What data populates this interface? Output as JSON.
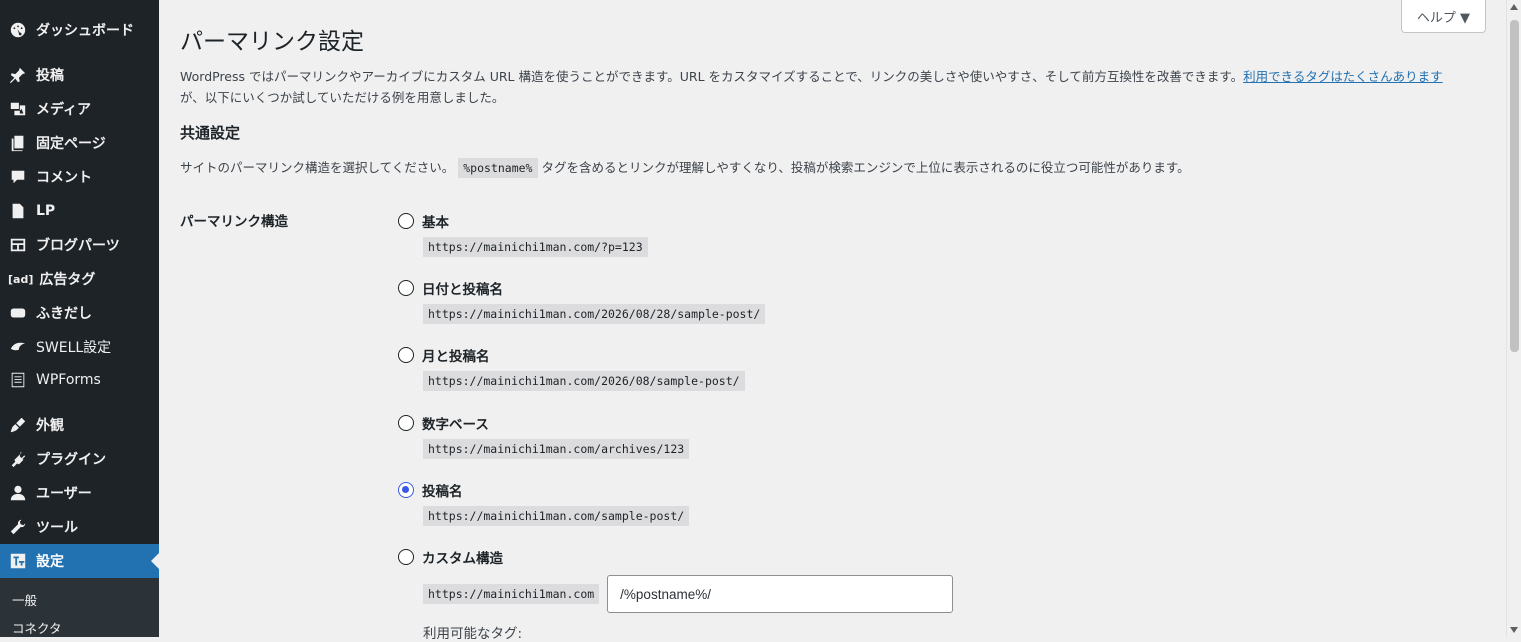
{
  "sidebar": {
    "items": [
      {
        "label": "ダッシュボード",
        "icon": "dashboard-icon"
      },
      {
        "label": "投稿",
        "icon": "pin-icon"
      },
      {
        "label": "メディア",
        "icon": "media-icon"
      },
      {
        "label": "固定ページ",
        "icon": "page-icon"
      },
      {
        "label": "コメント",
        "icon": "comment-icon"
      },
      {
        "label": "LP",
        "icon": "document-icon"
      },
      {
        "label": "ブログパーツ",
        "icon": "layout-icon"
      },
      {
        "label": "広告タグ",
        "icon": "ad-icon"
      },
      {
        "label": "ふきだし",
        "icon": "speech-bubble-icon"
      },
      {
        "label": "SWELL設定",
        "icon": "swell-icon"
      },
      {
        "label": "WPForms",
        "icon": "forms-icon"
      },
      {
        "label": "外観",
        "icon": "brush-icon"
      },
      {
        "label": "プラグイン",
        "icon": "plugin-icon"
      },
      {
        "label": "ユーザー",
        "icon": "user-icon"
      },
      {
        "label": "ツール",
        "icon": "wrench-icon"
      },
      {
        "label": "設定",
        "icon": "settings-icon",
        "active": true
      }
    ],
    "ad_icon_text": "[ad]",
    "submenu": [
      "一般",
      "コネクタ"
    ]
  },
  "help": {
    "label": "ヘルプ ▼"
  },
  "page": {
    "title": "パーマリンク設定",
    "intro_text": "WordPress ではパーマリンクやアーカイブにカスタム URL 構造を使うことができます。URL をカスタマイズすることで、リンクの美しさや使いやすさ、そして前方互換性を改善できます。",
    "intro_link": "利用できるタグはたくさんあります",
    "intro_tail": "が、以下にいくつか試していただける例を用意しました。",
    "section_title": "共通設定",
    "section_desc_before": "サイトのパーマリンク構造を選択してください。",
    "section_desc_code": "%postname%",
    "section_desc_after": "タグを含めるとリンクが理解しやすくなり、投稿が検索エンジンで上位に表示されるのに役立つ可能性があります。",
    "row_label": "パーマリンク構造"
  },
  "options": [
    {
      "label": "基本",
      "example": "https://mainichi1man.com/?p=123",
      "checked": false
    },
    {
      "label": "日付と投稿名",
      "example": "https://mainichi1man.com/2026/08/28/sample-post/",
      "checked": false
    },
    {
      "label": "月と投稿名",
      "example": "https://mainichi1man.com/2026/08/sample-post/",
      "checked": false
    },
    {
      "label": "数字ベース",
      "example": "https://mainichi1man.com/archives/123",
      "checked": false
    },
    {
      "label": "投稿名",
      "example": "https://mainichi1man.com/sample-post/",
      "checked": true
    },
    {
      "label": "カスタム構造",
      "checked": false
    }
  ],
  "custom": {
    "base": "https://mainichi1man.com",
    "value": "/%postname%/",
    "available_tags": "利用可能なタグ:"
  },
  "colors": {
    "sidebar": "#1d2327",
    "active": "#2271b1",
    "radio_checked": "#3858e9"
  }
}
